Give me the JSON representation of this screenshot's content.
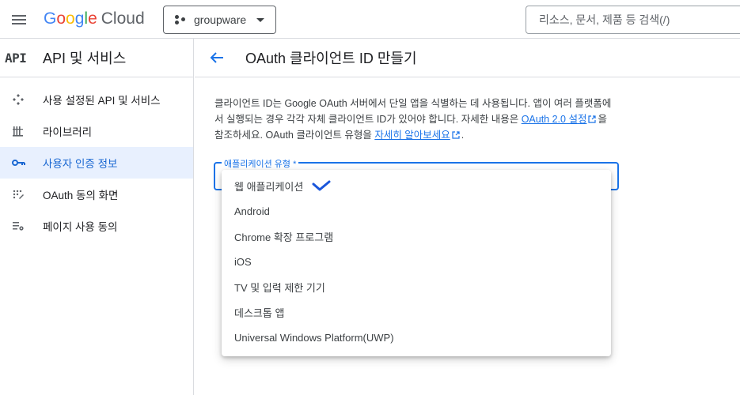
{
  "topbar": {
    "logo_google": [
      "G",
      "o",
      "o",
      "g",
      "l",
      "e"
    ],
    "logo_cloud": "Cloud",
    "project": "groupware",
    "search_placeholder": "리소스, 문서, 제품 등 검색(/)"
  },
  "sidebar": {
    "api_badge": "API",
    "title": "API 및 서비스",
    "items": [
      {
        "label": "사용 설정된 API 및 서비스",
        "icon": "api-services-icon"
      },
      {
        "label": "라이브러리",
        "icon": "library-icon"
      },
      {
        "label": "사용자 인증 정보",
        "icon": "key-icon",
        "active": true
      },
      {
        "label": "OAuth 동의 화면",
        "icon": "consent-icon"
      },
      {
        "label": "페이지 사용 동의",
        "icon": "settings-list-icon"
      }
    ]
  },
  "main": {
    "title": "OAuth 클라이언트 ID 만들기",
    "desc_part1": "클라이언트 ID는 Google OAuth 서버에서 단일 앱을 식별하는 데 사용됩니다. 앱이 여러 플랫폼에서 실행되는 경우 각각 자체 클라이언트 ID가 있어야 합니다. 자세한 내용은 ",
    "desc_link1": "OAuth 2.0 설정",
    "desc_part2": "을 참조하세요. OAuth 클라이언트 유형을 ",
    "desc_link2": "자세히 알아보세요",
    "desc_part3": ".",
    "select_label": "애플리케이션 유형 *"
  },
  "dropdown": {
    "options": [
      "웹 애플리케이션",
      "Android",
      "Chrome 확장 프로그램",
      "iOS",
      "TV 및 입력 제한 기기",
      "데스크톱 앱",
      "Universal Windows Platform(UWP)"
    ],
    "checked_index": 0
  },
  "colors": {
    "accent": "#1a73e8",
    "active_bg": "#e8f0fe",
    "check": "#1a56db"
  }
}
